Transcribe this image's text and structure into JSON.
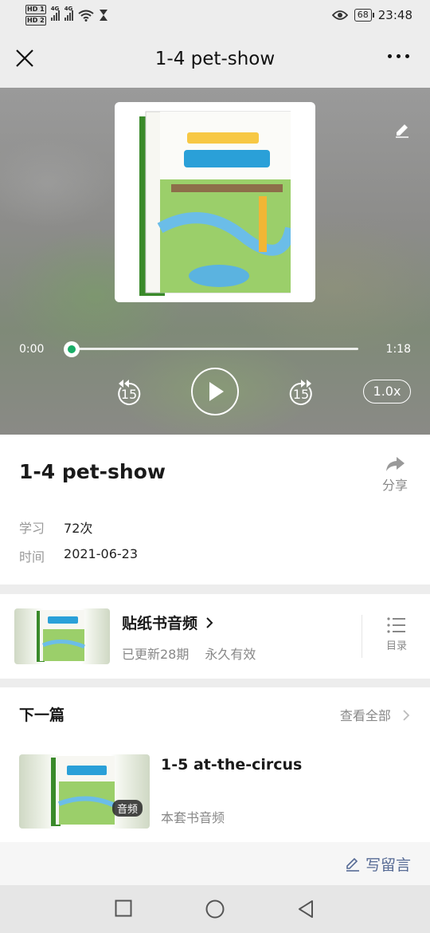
{
  "status_bar": {
    "hd1": "HD 1",
    "hd2": "HD 2",
    "net1": "4G",
    "net2": "4G",
    "battery": "68",
    "time": "23:48"
  },
  "nav": {
    "title": "1-4 pet-show"
  },
  "player": {
    "current_time": "0:00",
    "total_time": "1:18",
    "progress": 0,
    "skip_back": "15",
    "skip_forward": "15",
    "speed": "1.0x",
    "accent_color": "#1aad67"
  },
  "info": {
    "title": "1-4 pet-show",
    "share_label": "分享",
    "study_label": "学习",
    "study_value": "72次",
    "time_label": "时间",
    "time_value": "2021-06-23"
  },
  "album": {
    "name": "贴纸书音频",
    "updated": "已更新28期",
    "validity": "永久有效",
    "toc_label": "目录"
  },
  "next": {
    "label": "下一篇",
    "view_all": "查看全部",
    "title": "1-5 at-the-circus",
    "badge": "音频",
    "subtitle": "本套书音频"
  },
  "comment": {
    "write_label": "写留言",
    "color": "#576b95"
  }
}
